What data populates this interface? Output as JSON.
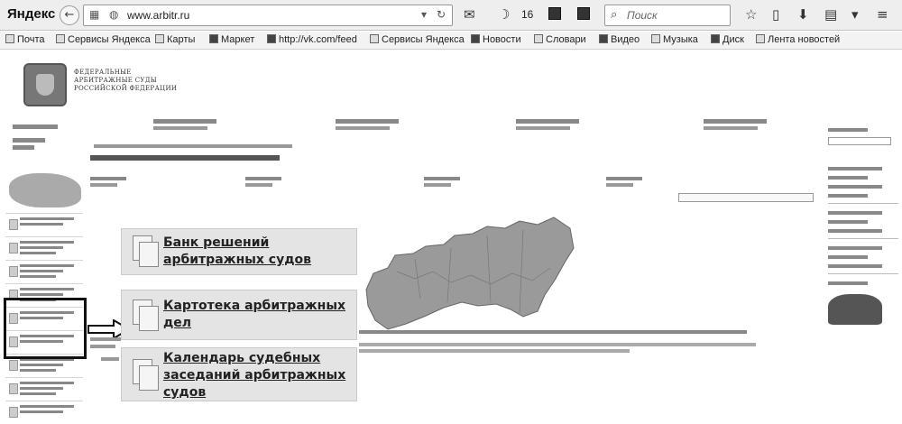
{
  "browser": {
    "brand": "Яндекс",
    "url": "www.arbitr.ru",
    "notification_count": "16",
    "search_placeholder": "Поиск"
  },
  "bookmarks": [
    {
      "label": "Почта"
    },
    {
      "label": "Сервисы Яндекса"
    },
    {
      "label": "Карты"
    },
    {
      "label": "Маркет"
    },
    {
      "label": "http://vk.com/feed"
    },
    {
      "label": "Сервисы Яндекса"
    },
    {
      "label": "Новости"
    },
    {
      "label": "Словари"
    },
    {
      "label": "Видео"
    },
    {
      "label": "Музыка"
    },
    {
      "label": "Диск"
    },
    {
      "label": "Лента новостей"
    }
  ],
  "site": {
    "org_name_lines": [
      "ФЕДЕРАЛЬНЫЕ",
      "АРБИТРАЖНЫЕ СУДЫ",
      "РОССИЙСКОЙ ФЕДЕРАЦИИ"
    ]
  },
  "callouts": [
    {
      "title": "Банк решений арбитражных судов"
    },
    {
      "title": "Картотека арбитражных дел"
    },
    {
      "title": "Календарь судебных заседаний арбитражных судов"
    }
  ],
  "colors": {
    "toolbar_bg": "#eeeeee",
    "card_bg": "#e4e4e4",
    "map_fill": "#9a9a9a",
    "highlight_border": "#111111"
  }
}
